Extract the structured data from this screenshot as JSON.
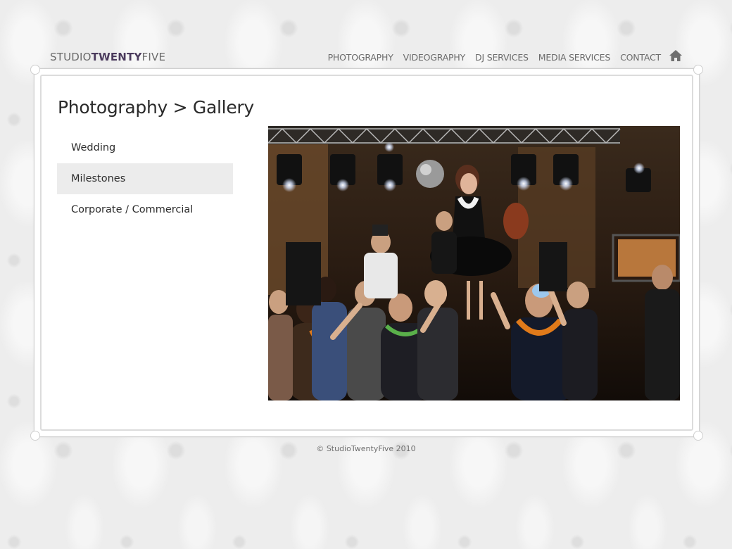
{
  "header": {
    "logo_prefix": "STUDIO",
    "logo_bold": "TWENTY",
    "logo_suffix": "FIVE",
    "nav": [
      {
        "label": "PHOTOGRAPHY"
      },
      {
        "label": "VIDEOGRAPHY"
      },
      {
        "label": "DJ SERVICES"
      },
      {
        "label": "MEDIA SERVICES"
      },
      {
        "label": "CONTACT"
      }
    ],
    "home_icon": "home-icon"
  },
  "main": {
    "title": "Photography > Gallery",
    "menu": [
      {
        "label": "Wedding"
      },
      {
        "label": "Milestones",
        "active": true
      },
      {
        "label": "Corporate / Commercial"
      }
    ],
    "photo_subject": "party-photo"
  },
  "footer": {
    "copyright": "© StudioTwentyFive 2010"
  },
  "colors": {
    "brand": "#4b3b5d",
    "nav_text": "#6b6b6b",
    "active_bg": "#ececec"
  }
}
